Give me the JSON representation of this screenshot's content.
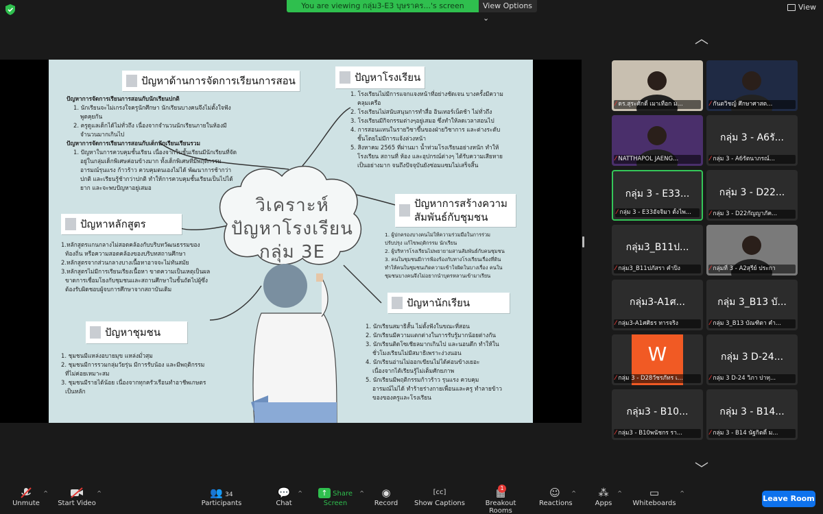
{
  "banner": {
    "text": "You are viewing กลุ่ม3-E3 บุษราคร...'s screen",
    "view_options": "View Options"
  },
  "view_button": "View",
  "slide": {
    "cloud_title_lines": [
      "วิเคราะห์",
      "ปัญหาโรงเรียน",
      "กลุ่ม 3E"
    ],
    "labels": {
      "teaching": "ปัญหาด้านการจัดการเรียนการสอน",
      "school": "ปัญหาโรงเรียน",
      "curriculum": "ปัญหาหลักสูตร",
      "community_rel": "ปัญหาการสร้างความสัมพันธ์กับชุมชน",
      "community": "ปัญหาชุมชน",
      "students": "ปัญหานักเรียน"
    },
    "teaching_text": {
      "h1": "ปัญหาการจัดการเรียนการสอนกับนักเรียนปกติ",
      "l1": "1. นักเรียนจะไม่เกรงใจครูนักศึกษา นักเรียนบางคนจึงไม่ตั้งใจฟัง",
      "l1b": "พูดคุยกัน",
      "l2": "2. ครูดูแลเด็กได้ไม่ทั่วถึง เนื่องจากจำนวนนักเรียนภายในห้องมี",
      "l2b": "จำนวนมากเกินไป",
      "h2": "ปัญหาการจัดการเรียนการสอนกับเด็กนักเรียนเรียนรวม",
      "l3": "1. ปัญหาในการควบคุมชั้นเรียน เนื่องจากในชั้นเรียนมีนักเรียนที่จัด",
      "l3b": "อยู่ในกลุ่มเด็กพิเศษค่อนข้างมาก ทั้งเด็กพิเศษที่มีพฤติกรรม",
      "l3c": "อารมณ์รุนแรง ก้าวร้าว ควบคุมตนเองไม่ได้ พัฒนาการช้ากว่า",
      "l3d": "ปกติ และเรียนรู้ช้ากว่าปกติ ทำให้การควบคุมชั้นเรียนเป็นไปได้",
      "l3e": "ยาก และจะพบปัญหาอยู่เสมอ"
    },
    "school_text": [
      "1. โรงเรียนไม่มีการแจกแจงหน้าที่อย่างชัดเจน บางครั้งมีความ",
      "คลุมเครือ",
      "2. โรงเรียนไม่สนับสนุนการทำสื่อ อินเทอร์เน็ตช้า ไม่ทั่วถึง",
      "3. โรงเรียนมีกิจกรรมต่างๆอยู่เสมอ ซึ่งทำให้ลดเวลาสอนไป",
      "4. การสอนแทนในรายวิชาขึ้นของฝ่ายวิชาการ และต่างระดับ",
      "ชั้นโดยไม่มีการแจ้งล่วงหน้า",
      "5. สิงหาคม 2565 ที่ผ่านมา น้ำท่วมโรงเรียนอย่างหนัก ทำให้",
      "โรงเรียน สถานที่ ห้อง และอุปกรณ์ต่างๆ ได้รับความเสียหาย",
      "เป็นอย่างมาก จนถึงปัจจุบันยังซ่อมแซมไม่เสร็จสิ้น"
    ],
    "curriculum_text": [
      "1.หลักสูตรแกนกลางไม่สอดคล้องกับบริบทวัฒนธรรมของ",
      "ท้องถิ่น หรือความสอดคล้องของบริบทสถานศึกษา",
      "2.หลักสูตรจากส่วนกลางบางเนื้อหาอาจจะไม่ทันสมัย",
      "3.หลักสูตรไม่มีการเรียนเรียงเนื้อหา ขาดความเป็นเหตุเป็นผล",
      "ขาดการเชื่อมโยงกับชุมชนและสถานศึกษาในชั้นถัดไปผู้ซึ่ง",
      "ต้องรับผิดชอบผู้จบการศึกษาจากสถาบันเดิม"
    ],
    "community_rel_text": [
      "1. ผู้ปกครองบางคนไม่ให้ความร่วมมือในการร่วม",
      "ปรับปรุง แก้ไขพฤติกรรม นักเรียน",
      "2. ผู้บริหารโรงเรียนไม่พยายามสานสัมพันธ์กับคนชุมชน",
      "3. คนในชุมชนมีการฟ้องร้องกับทางโรงเรียนเรื่องที่ดิน",
      "ทำให้คนในชุมชนเกิดความเข้าใจผิดในบางเรื่อง คนใน",
      "ชุมชนบางคนจึงไม่อยากนำบุตรหลานเข้ามาเรียน"
    ],
    "community_text": [
      "1. ชุมชนมีแหล่งอบายมุข แหล่งมั่วสุม",
      "2. ชุมชนมีการรวมกลุ่มวัยรุ่น มีการรับน้อง และมีพฤติกรรม",
      "ที่ไม่ค่อยเหมาะสม",
      "3. ชุมชนมีรายได้น้อย เนื่องจากทุกครัวเรือนทำอาชีพเกษตร",
      "เป็นหลัก"
    ],
    "students_text": [
      "1. นักเรียนสมาธิสั้น ไม่ตั้งฟังในขณะที่สอน",
      "2. นักเรียนมีความแตกต่างในการรับรู้มากน้อยต่างกัน",
      "3. นักเรียนติดโซเชียลมากเกินไป และนอนดึก ทำให้ใน",
      "ชั่วโมงเรียนไม่มีสมาธิเพราะง่วงนอน",
      "4. นักเรียนอ่านไม่ออกเขียนไม่ได้ค่อนข้างเยอะ",
      "เนื่องจากได้เรียนรู้ไม่เต็มศักยภาพ",
      "5. นักเรียนมีพฤติกรรมก้าวร้าว รุนแรง ควบคุม",
      "อารมณ์ไม่ได้ ทำร้ายร่างกายเพื่อนและครู ทำลายข้าว",
      "ของของครูและโรงเรียน"
    ]
  },
  "gallery": [
    {
      "big": "",
      "name": "ดร.สุระศักดิ์ เมาเทือก ม...",
      "video": "person1",
      "muted": true
    },
    {
      "big": "",
      "name": "กันตวิชญ์ ศึกษาศาสต...",
      "video": "person2",
      "muted": true
    },
    {
      "big": "",
      "name": "NATTHAPOL JAENG...",
      "video": "person3",
      "muted": true
    },
    {
      "big": "กลุ่ม 3 - A6รั...",
      "name": "กลุ่ม 3 - A6รัตนาภรณ์...",
      "video": "",
      "muted": true
    },
    {
      "big": "กลุ่ม 3 - E33...",
      "name": "กลุ่ม 3 - E33อัจจิมา ตั้งไพ...",
      "video": "",
      "muted": true,
      "active": true
    },
    {
      "big": "กลุ่ม 3 - D22...",
      "name": "กลุ่ม 3 - D22กัญญาภัค...",
      "video": "",
      "muted": true
    },
    {
      "big": "กลุ่ม3_B11ป...",
      "name": "กลุ่ม3_B11ปภัสรา คำปิ๋ง",
      "video": "",
      "muted": true
    },
    {
      "big": "",
      "name": "กลุ่มที่ 3 - A2สุรีย์ ประกา",
      "video": "person4",
      "muted": true
    },
    {
      "big": "กลุ่ม3-A1ศ...",
      "name": "กลุ่ม3-A1ศศิธร ทารจริง",
      "video": "",
      "muted": true
    },
    {
      "big": "กลุ่ม 3_B13 บั...",
      "name": "กลุ่ม 3_B13 บัณฑิตา คำ...",
      "video": "",
      "muted": true
    },
    {
      "big": "W",
      "name": "กลุ่ม 3 - D28วัชรภัทร เ...",
      "video": "w",
      "muted": true
    },
    {
      "big": "กลุ่ม 3 D-24...",
      "name": "กลุ่ม 3 D-24 วิภา ปาทุ...",
      "video": "",
      "muted": true
    },
    {
      "big": "กลุ่ม3 - B10...",
      "name": "กลุ่ม3 - B10พนัชกร รา...",
      "video": "",
      "muted": true
    },
    {
      "big": "กลุ่ม 3 - B14...",
      "name": "กลุ่ม 3 - B14 นัฐกิตติ์ ม...",
      "video": "",
      "muted": true
    }
  ],
  "toolbar": {
    "unmute": "Unmute",
    "start_video": "Start Video",
    "participants": "Participants",
    "participants_count": "34",
    "chat": "Chat",
    "share": "Share Screen",
    "record": "Record",
    "captions": "Show Captions",
    "breakout": "Breakout Rooms",
    "breakout_badge": "1",
    "reactions": "Reactions",
    "apps": "Apps",
    "whiteboards": "Whiteboards",
    "leave": "Leave Room"
  }
}
